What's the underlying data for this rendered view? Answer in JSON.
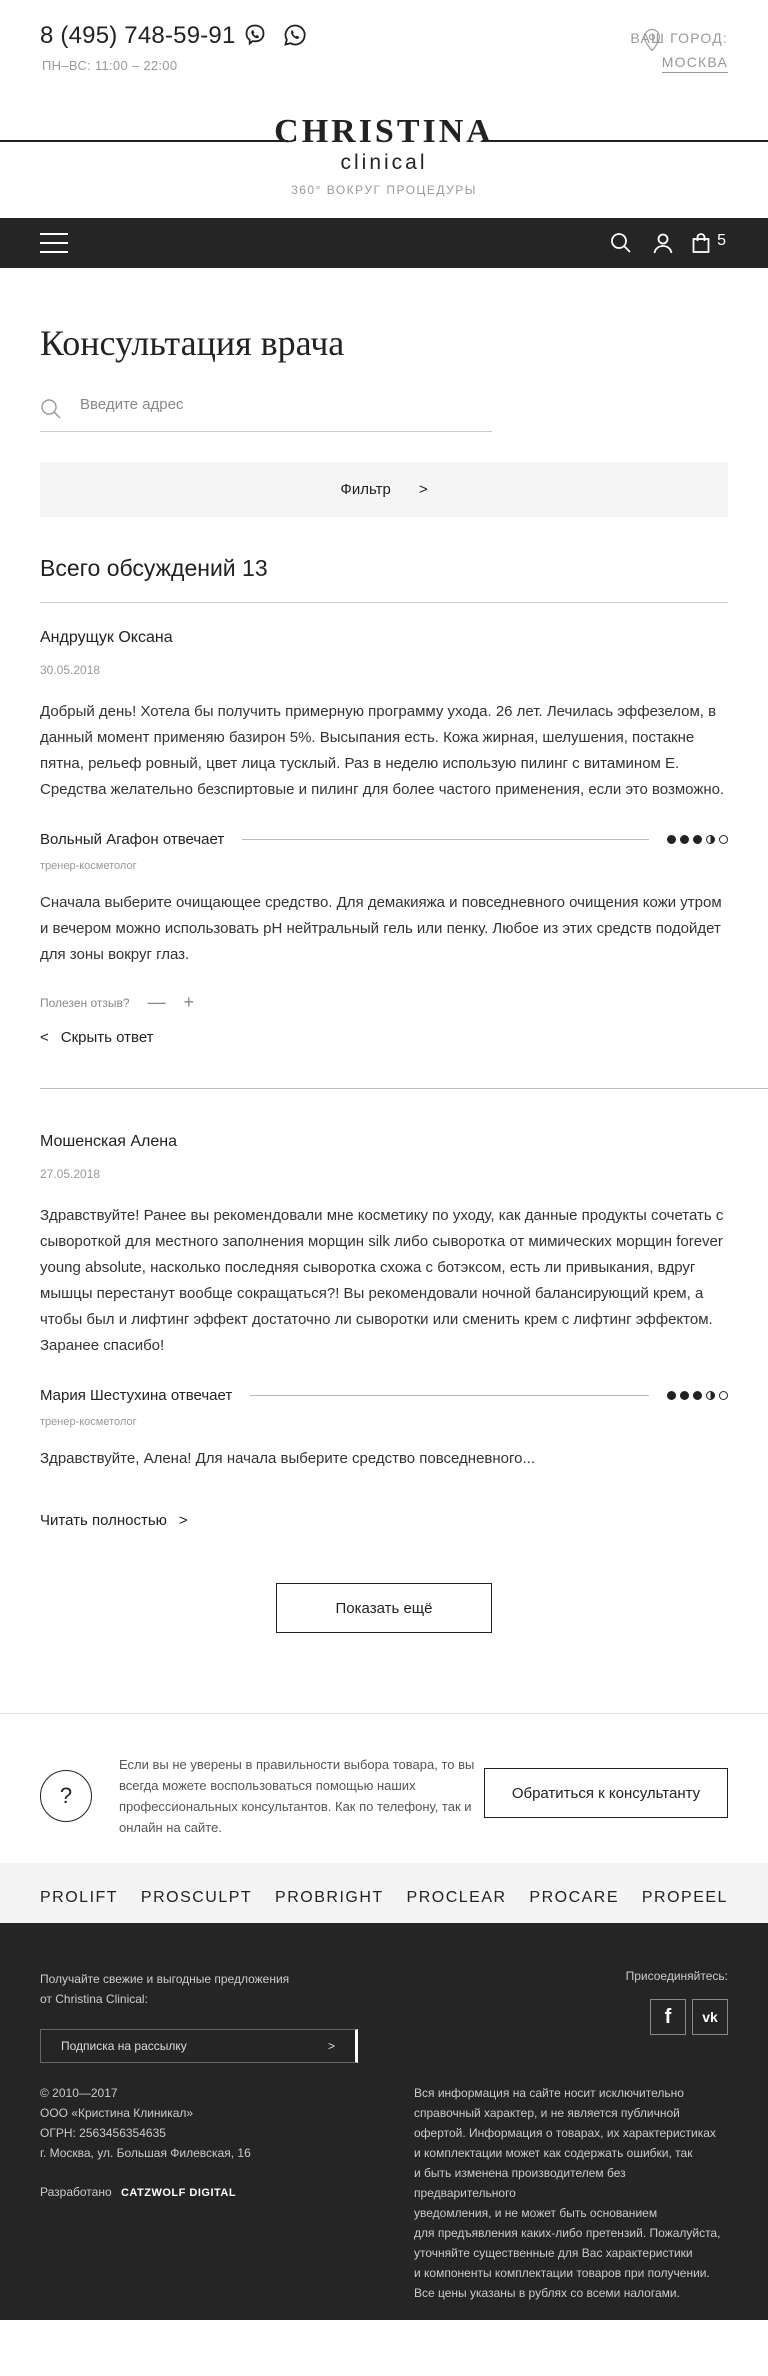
{
  "header": {
    "phone": "8 (495) 748-59-91",
    "hours": "ПН–ВС: 11:00 – 22:00",
    "city_label": "ВАШ ГОРОД:",
    "city_value": "МОСКВА",
    "logo_main": "CHRISTINA",
    "logo_sub": "clinical",
    "logo_tagline": "360° ВОКРУГ ПРОЦЕДУРЫ",
    "icons": [
      "viber-icon",
      "whatsapp-icon",
      "location-pin-icon"
    ]
  },
  "navbar": {
    "icons": [
      "menu-icon",
      "search-icon",
      "user-icon",
      "cart-icon"
    ],
    "cart_count": "5",
    "background": "#252525"
  },
  "main": {
    "title": "Консультация врача",
    "search_placeholder": "Введите адрес",
    "filter_label": "Фильтр",
    "total_label": "Всего обсуждений 13"
  },
  "discussions": [
    {
      "author": "Андрущук Оксана",
      "date": "30.05.2018",
      "question": "Добрый день! Хотела бы получить примерную программу ухода. 26 лет. Лечилась эффезелом, в данный момент применяю базирон 5%. Высыпания есть. Кожа жирная, шелушения, постакне пятна, рельеф ровный, цвет лица тусклый. Раз в неделю использую пилинг с витамином Е. Средства желательно безспиртовые и пилинг для более частого применения, если это возможно.",
      "answerer": "Вольный Агафон отвечает",
      "role": "тренер-косметолог",
      "rating": 3.5,
      "answer": "Сначала выберите очищающее средство. Для демакияжа и повседневного очищения кожи утром и вечером можно использовать pH нейтральный гель или пенку. Любое из этих средств подойдет для зоны вокруг глаз.",
      "useful_label": "Полезен отзыв?",
      "minus": "—",
      "plus": "+",
      "toggle_label": "Скрыть ответ"
    },
    {
      "author": "Мошенская Алена",
      "date": "27.05.2018",
      "question": "Здравствуйте! Ранее вы рекомендовали мне косметику по уходу, как данные продукты сочетать с сывороткой для местного заполнения морщин silk либо сыворотка от мимических морщин forever young absolute, насколько последняя сыворотка схожа с ботэксом, есть ли привыкания, вдруг мышцы перестанут вообще сокращаться?! Вы рекомендовали ночной балансирующий крем, а чтобы был и лифтинг эффект достаточно ли сыворотки или сменить крем с лифтинг эффектом. Заранее спасибо!",
      "answerer": "Мария Шестухина отвечает",
      "role": "тренер-косметолог",
      "rating": 3.5,
      "answer": "Здравствуйте, Алена! Для начала выберите средство повседневного...",
      "toggle_label": "Читать полностью"
    }
  ],
  "show_more_label": "Показать ещё",
  "consult": {
    "text": "Если вы не уверены в правильности выбора товара, то вы всегда можете воспользоваться помощью наших профессиональных консультантов. Как по телефону, так и онлайн на сайте.",
    "question_mark": "?",
    "button_label": "Обратиться к консультанту"
  },
  "brands": [
    "PROLIFT",
    "PROSCULPT",
    "PROBRIGHT",
    "PROCLEAR",
    "PROCARE",
    "PROPEEL"
  ],
  "footer": {
    "news_line1": "Получайте свежие и выгодные предложения",
    "news_line2": "от Christina Clinical:",
    "subscribe_label": "Подписка на рассылку",
    "join_label": "Присоединяйтесь:",
    "social": [
      "f",
      "vk"
    ],
    "copy": [
      "© 2010—2017",
      "ООО «Кристина Клиникал»",
      "ОГРН: 2563456354635",
      "г. Москва, ул. Большая Филевская, 16"
    ],
    "dev_label": "Разработано",
    "dev_name": "CATZWOLF DIGITAL",
    "legal": [
      "Вся информация на сайте носит исключительно",
      "справочный характер, и не является публичной",
      "офертой. Информация о товарах, их характеристиках",
      "и комплектации может как содержать ошибки, так",
      "и быть изменена производителем без предварительного",
      "уведомления, и не может быть основанием",
      "для предъявления каких-либо претензий. Пожалуйста,",
      "уточняйте существенные для Вас характеристики",
      "и компоненты комплектации товаров при получении.",
      "Все цены указаны в рублях со всеми налогами."
    ]
  }
}
